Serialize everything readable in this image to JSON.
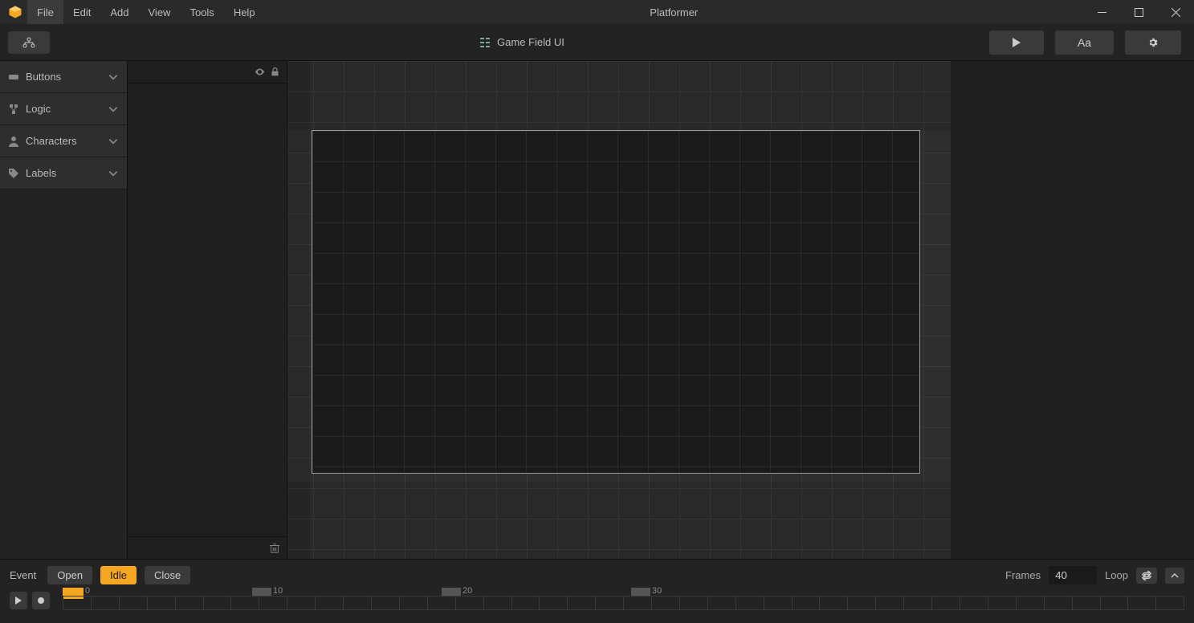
{
  "title": "Platformer",
  "menu": {
    "file": "File",
    "edit": "Edit",
    "add": "Add",
    "view": "View",
    "tools": "Tools",
    "help": "Help"
  },
  "toolbar": {
    "center_label": "Game Field UI"
  },
  "sidebar": {
    "items": [
      {
        "label": "Buttons"
      },
      {
        "label": "Logic"
      },
      {
        "label": "Characters"
      },
      {
        "label": "Labels"
      }
    ]
  },
  "timeline": {
    "event_label": "Event",
    "open": "Open",
    "idle": "Idle",
    "close": "Close",
    "frames_label": "Frames",
    "frames_value": "40",
    "loop_label": "Loop",
    "ticks": {
      "t0": "0",
      "t10": "10",
      "t20": "20",
      "t30": "30"
    }
  }
}
